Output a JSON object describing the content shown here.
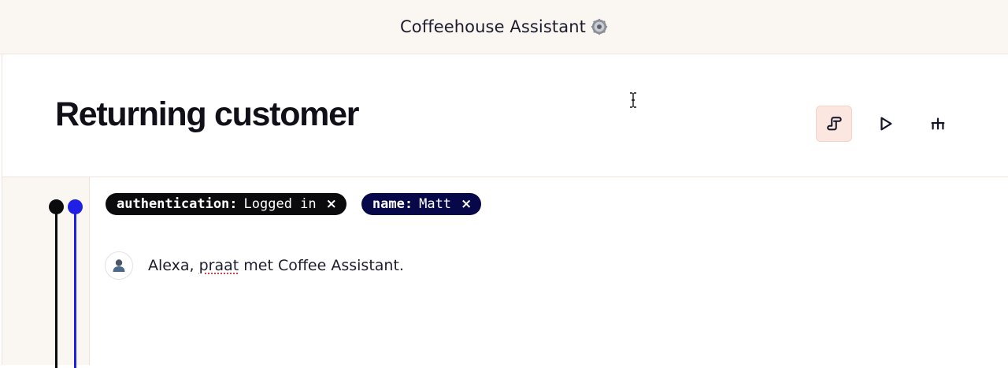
{
  "app": {
    "title": "Coffeehouse Assistant",
    "title_icon": "gear-icon"
  },
  "header": {
    "title": "Returning customer",
    "tools": [
      {
        "name": "script-icon",
        "active": true
      },
      {
        "name": "play-icon",
        "active": false
      },
      {
        "name": "branch-icon",
        "active": false
      }
    ]
  },
  "tags": [
    {
      "key": "authentication:",
      "value": "Logged in",
      "close": "×",
      "color": "#0b0b0e"
    },
    {
      "key": "name:",
      "value": "Matt",
      "close": "×",
      "color": "#07084a"
    }
  ],
  "message": {
    "avatar_icon": "user-icon",
    "text_before": "Alexa, ",
    "text_misspelled": "praat",
    "text_after": " met Coffee Assistant."
  },
  "colors": {
    "accent_blue": "#1f1fe6",
    "track_black": "#0b0b0e",
    "active_tool_bg": "#fbe7e0",
    "header_bg": "#faf6f2"
  }
}
